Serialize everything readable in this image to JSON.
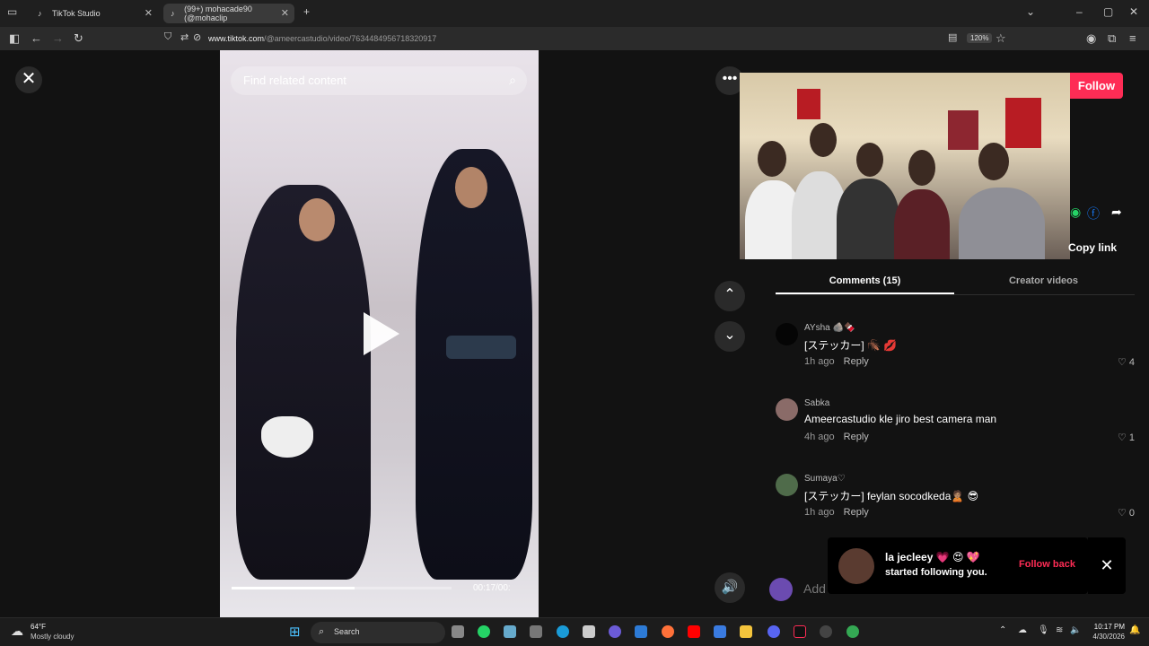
{
  "browser": {
    "tabs": [
      {
        "label": "TikTok Studio"
      },
      {
        "label": "(99+) mohacade90 (@mohaclip"
      }
    ],
    "url_host": "www.tiktok.com",
    "url_path": "/@ameercastudio/video/7634484956718320917",
    "zoom": "120%"
  },
  "video": {
    "search_placeholder": "Find related content",
    "time": "00:17/00:",
    "progress": 0.56
  },
  "creator": {
    "follow_label": "Follow",
    "copy_link_label": "Copy link"
  },
  "tabs": {
    "comments": "Comments (15)",
    "creator_videos": "Creator videos"
  },
  "comments": [
    {
      "user": "AYsha 🪨🍫",
      "text": "[ステッカー] 🪳 💋",
      "time": "1h ago",
      "reply": "Reply",
      "likes": "4",
      "avatar_color": "#050505"
    },
    {
      "user": "Sabka",
      "text": "Ameercastudio kle jiro best camera man",
      "time": "4h ago",
      "reply": "Reply",
      "likes": "1",
      "avatar_color": "#8a6b68"
    },
    {
      "user": "Sumaya♡",
      "text": "[ステッカー] feylan socodkeda🙎🏽 😎",
      "time": "1h ago",
      "reply": "Reply",
      "likes": "0",
      "avatar_color": "#4f6b4a"
    }
  ],
  "comment_input": {
    "placeholder": "Add"
  },
  "toast": {
    "name": "la jecleey 💗 😍 💖",
    "message": "started following you.",
    "follow_back": "Follow back"
  },
  "taskbar": {
    "weather_temp": "64°F",
    "weather_desc": "Mostly cloudy",
    "search_label": "Search",
    "time": "10:17 PM",
    "date": "4/30/2026"
  }
}
